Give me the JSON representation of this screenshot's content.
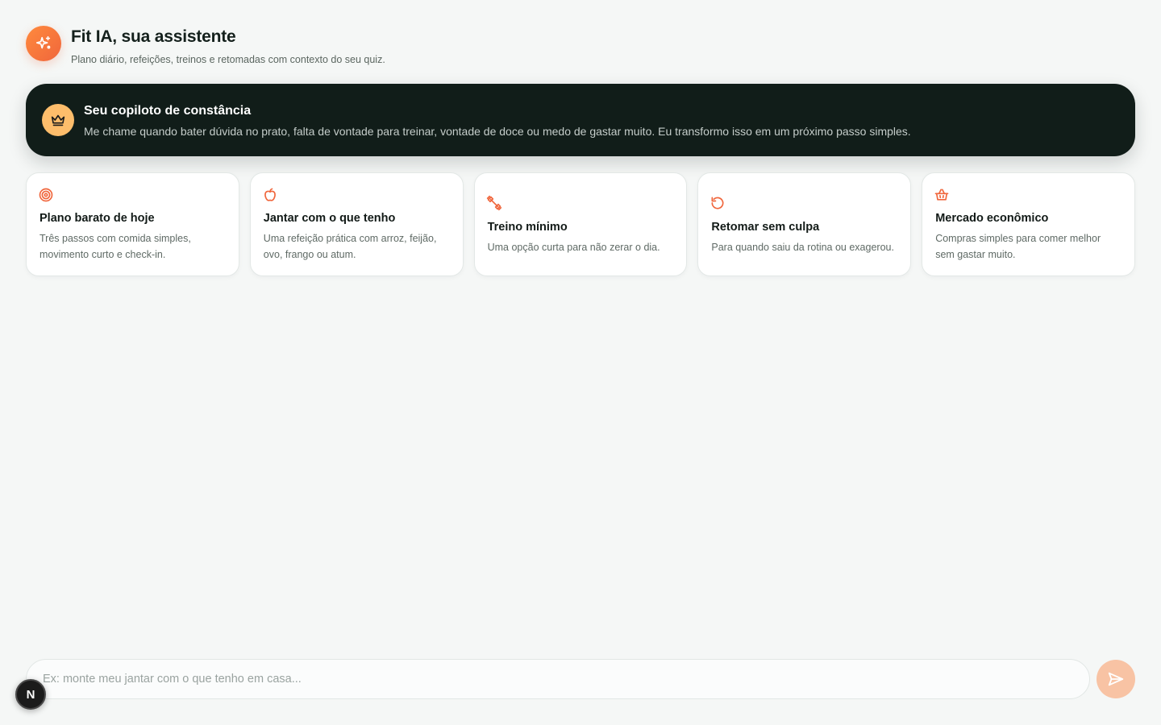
{
  "header": {
    "title": "Fit IA, sua assistente",
    "subtitle": "Plano diário, refeições, treinos e retomadas com contexto do seu quiz.",
    "icon": "sparkles-icon"
  },
  "banner": {
    "icon": "crown-icon",
    "title": "Seu copiloto de constância",
    "description": "Me chame quando bater dúvida no prato, falta de vontade para treinar, vontade de doce ou medo de gastar muito. Eu transformo isso em um próximo passo simples."
  },
  "suggestions": [
    {
      "icon": "target-icon",
      "title": "Plano barato de hoje",
      "description": "Três passos com comida simples, movimento curto e check-in."
    },
    {
      "icon": "apple-icon",
      "title": "Jantar com o que tenho",
      "description": "Uma refeição prática com arroz, feijão, ovo, frango ou atum."
    },
    {
      "icon": "dumbbell-icon",
      "title": "Treino mínimo",
      "description": "Uma opção curta para não zerar o dia."
    },
    {
      "icon": "rotate-ccw-icon",
      "title": "Retomar sem culpa",
      "description": "Para quando saiu da rotina ou exagerou."
    },
    {
      "icon": "basket-icon",
      "title": "Mercado econômico",
      "description": "Compras simples para comer melhor sem gastar muito."
    }
  ],
  "composer": {
    "placeholder": "Ex: monte meu jantar com o que tenho em casa...",
    "send_icon": "send-icon"
  },
  "dev_badge": {
    "label": "N"
  },
  "colors": {
    "accent": "#f0663c",
    "banner_bg": "#111d19",
    "crown_bg": "#fdbd6b",
    "send_bg": "#f8c3a4",
    "page_bg": "#f5f7f6"
  }
}
